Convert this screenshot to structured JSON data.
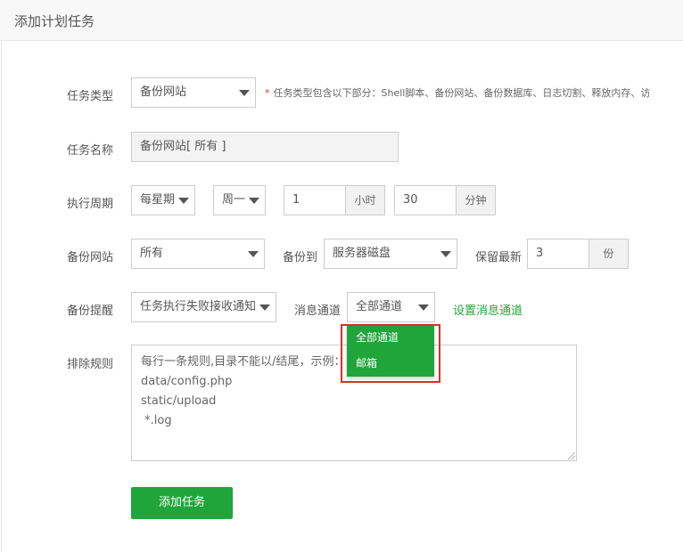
{
  "header": {
    "title": "添加计划任务"
  },
  "form": {
    "task_type": {
      "label": "任务类型",
      "value": "备份网站",
      "hint_star": "*",
      "hint": "任务类型包含以下部分：Shell脚本、备份网站、备份数据库、日志切割、释放内存、访"
    },
    "task_name": {
      "label": "任务名称",
      "value": "备份网站[ 所有 ]"
    },
    "period": {
      "label": "执行周期",
      "freq": "每星期",
      "weekday": "周一",
      "hour_value": "1",
      "hour_unit": "小时",
      "minute_value": "30",
      "minute_unit": "分钟"
    },
    "backup_site": {
      "label": "备份网站",
      "value": "所有",
      "backup_to_label": "备份到",
      "backup_to": "服务器磁盘",
      "keep_label": "保留最新",
      "keep_value": "3",
      "keep_unit": "份"
    },
    "notify": {
      "label": "备份提醒",
      "value": "任务执行失败接收通知",
      "channel_label": "消息通道",
      "channel_value": "全部通道",
      "channel_link": "设置消息通道",
      "channel_options": [
        "全部通道",
        "邮箱"
      ]
    },
    "exclude": {
      "label": "排除规则",
      "lines": [
        "每行一条规则,目录不能以/结尾，示例：",
        "data/config.php",
        "static/upload",
        " *.log"
      ]
    },
    "submit_label": "添加任务"
  },
  "colors": {
    "accent": "#20a53a",
    "highlight": "#d9302a"
  }
}
